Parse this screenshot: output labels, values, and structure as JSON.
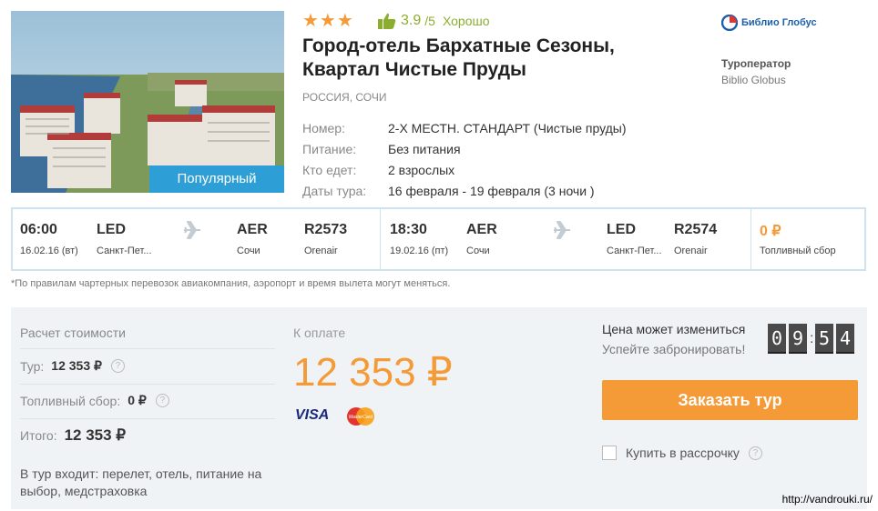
{
  "hotel": {
    "badge": "Популярный",
    "stars": "★★★",
    "rating_score": "3.9",
    "rating_max": "/5",
    "rating_word": "Хорошо",
    "name": "Город-отель Бархатные Сезоны, Квартал Чистые Пруды",
    "location": "РОССИЯ, СОЧИ",
    "details": [
      {
        "label": "Номер:",
        "value": "2-Х МЕСТН. СТАНДАРТ (Чистые пруды)"
      },
      {
        "label": "Питание:",
        "value": "Без питания"
      },
      {
        "label": "Кто едет:",
        "value": "2 взрослых"
      },
      {
        "label": "Даты тура:",
        "value": "16 февраля - 19 февраля (3 ночи )"
      }
    ]
  },
  "operator": {
    "logo_text": "Библио Глобус",
    "label": "Туроператор",
    "name": "Biblio Globus"
  },
  "flights": {
    "outbound": {
      "time": "06:00",
      "date": "16.02.16 (вт)",
      "from_code": "LED",
      "from_city": "Санкт-Пет...",
      "to_code": "AER",
      "to_city": "Сочи",
      "flight_no": "R2573",
      "airline": "Orenair"
    },
    "return": {
      "time": "18:30",
      "date": "19.02.16 (пт)",
      "from_code": "AER",
      "from_city": "Сочи",
      "to_code": "LED",
      "to_city": "Санкт-Пет...",
      "flight_no": "R2574",
      "airline": "Orenair"
    },
    "fuel": {
      "price": "0 ₽",
      "label": "Топливный сбор"
    }
  },
  "note": "*По правилам чартерных перевозок авиакомпания, аэропорт и время вылета могут меняться.",
  "calc": {
    "title": "Расчет стоимости",
    "tour_label": "Тур:",
    "tour_value": "12 353 ₽",
    "fuel_label": "Топливный сбор:",
    "fuel_value": "0 ₽",
    "total_label": "Итого:",
    "total_value": "12 353 ₽",
    "includes": "В тур входит: перелет, отель, питание на выбор, медстраховка"
  },
  "payment": {
    "label": "К оплате",
    "amount": "12 353 ₽",
    "visa": "VISA",
    "mastercard": "MasterCard"
  },
  "booking": {
    "price_change": "Цена может измениться",
    "hurry": "Успейте забронировать!",
    "timer": [
      "0",
      "9",
      "5",
      "4"
    ],
    "order_button": "Заказать тур",
    "installment": "Купить в рассрочку",
    "help": "?"
  },
  "colors": {
    "accent": "#f49a37",
    "badge": "#2e9fd6",
    "rating": "#8cae2e"
  },
  "watermark": "http://vandrouki.ru/"
}
